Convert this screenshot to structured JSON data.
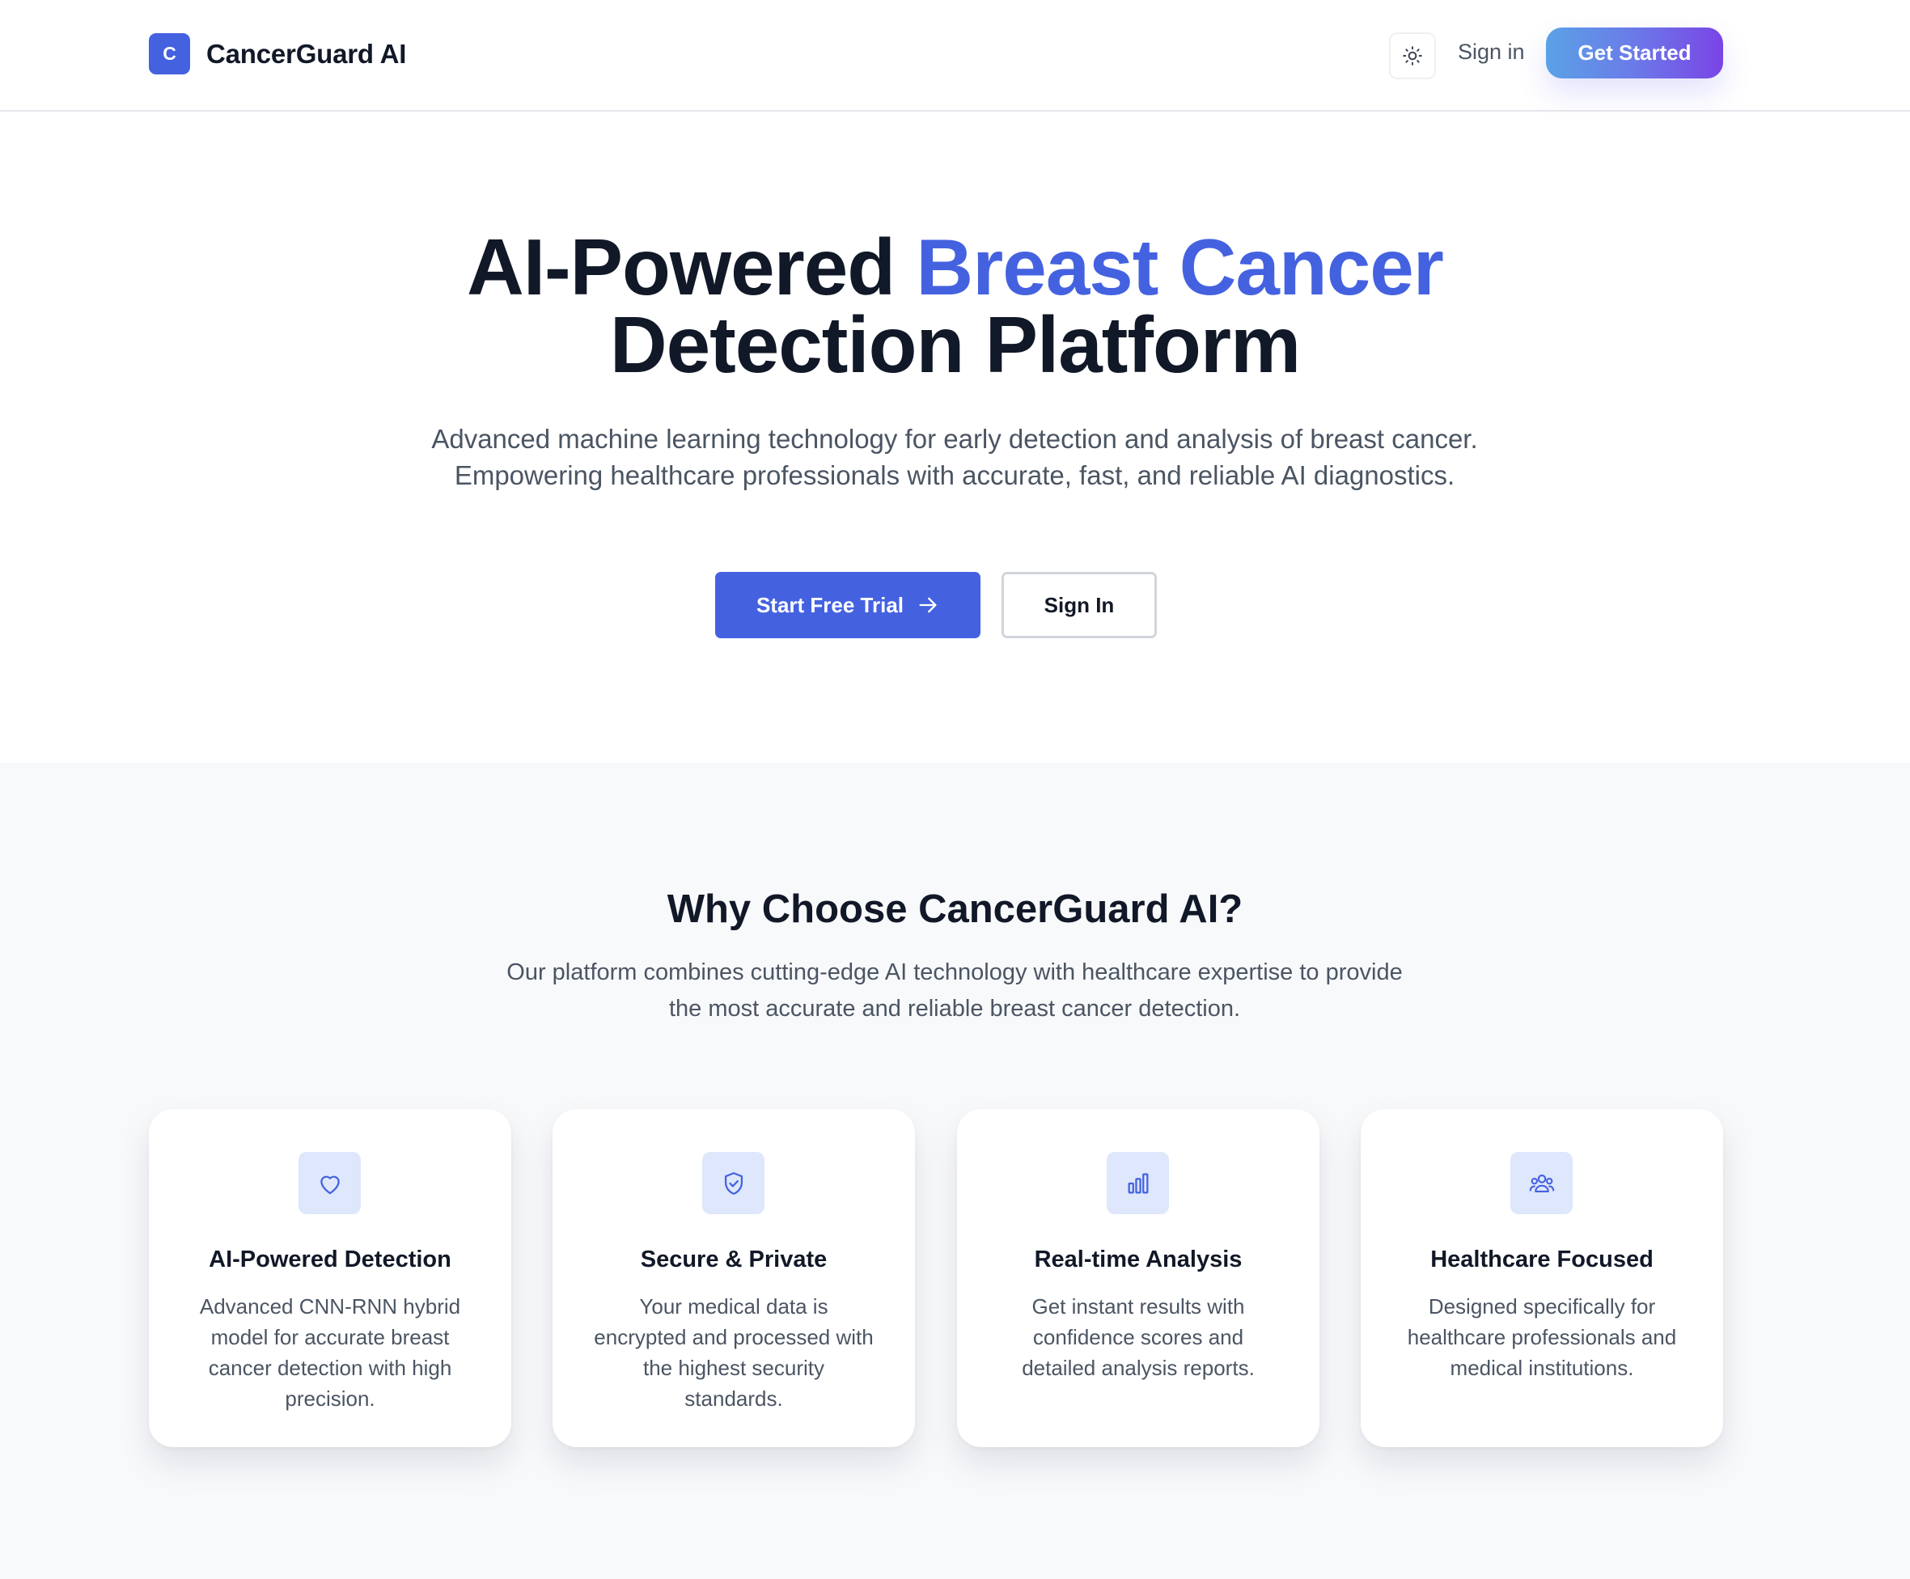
{
  "header": {
    "brand_initial": "C",
    "brand_name": "CancerGuard AI",
    "theme_toggle_icon": "sun-icon",
    "signin_label": "Sign in",
    "get_started_label": "Get Started"
  },
  "hero": {
    "title_part1": "AI-Powered ",
    "title_accent": "Breast Cancer",
    "title_line2": "Detection Platform",
    "subtitle": "Advanced machine learning technology for early detection and analysis of breast cancer. Empowering healthcare professionals with accurate, fast, and reliable AI diagnostics.",
    "primary_cta": "Start Free Trial",
    "secondary_cta": "Sign In"
  },
  "features": {
    "title": "Why Choose CancerGuard AI?",
    "subtitle": "Our platform combines cutting-edge AI technology with healthcare expertise to provide the most accurate and reliable breast cancer detection.",
    "cards": [
      {
        "icon": "heart-icon",
        "title": "AI-Powered Detection",
        "description": "Advanced CNN-RNN hybrid model for accurate breast cancer detection with high precision."
      },
      {
        "icon": "shield-check-icon",
        "title": "Secure & Private",
        "description": "Your medical data is encrypted and processed with the highest security standards."
      },
      {
        "icon": "bar-chart-icon",
        "title": "Real-time Analysis",
        "description": "Get instant results with confidence scores and detailed analysis reports."
      },
      {
        "icon": "users-icon",
        "title": "Healthcare Focused",
        "description": "Designed specifically for healthcare professionals and medical institutions."
      }
    ]
  },
  "colors": {
    "accent": "#4462e0",
    "text_dark": "#111827",
    "text_muted": "#4b5563",
    "section_bg": "#f8f9fb",
    "icon_bg": "#dee7fb"
  }
}
